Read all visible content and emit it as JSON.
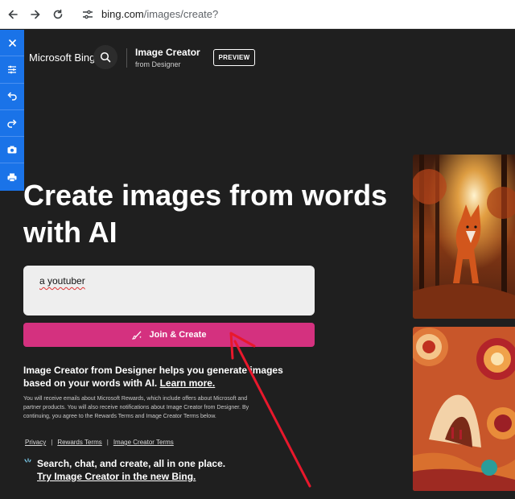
{
  "browser": {
    "url_host": "bing.com",
    "url_path": "/images/create?"
  },
  "side_toolbar": {
    "tools": [
      "close-icon",
      "sliders-icon",
      "undo-icon",
      "redo-icon",
      "camera-icon",
      "print-icon"
    ]
  },
  "header": {
    "brand": "Microsoft Bing",
    "product_title": "Image Creator",
    "product_subtitle": "from Designer",
    "badge": "PREVIEW"
  },
  "hero": {
    "headline": "Create images from words with AI"
  },
  "prompt": {
    "value": "a youtuber"
  },
  "actions": {
    "join_label": "Join & Create"
  },
  "description": {
    "text": "Image Creator from Designer helps you generate images based on your words with AI. ",
    "learn_more": "Learn more.",
    "fine_print": "You will receive emails about Microsoft Rewards, which include offers about Microsoft and partner products. You will also receive notifications about Image Creator from Designer. By continuing, you agree to the Rewards Terms and Image Creator Terms below."
  },
  "footer": {
    "privacy": "Privacy",
    "rewards_terms": "Rewards Terms",
    "ic_terms": "Image Creator Terms",
    "separator": "|"
  },
  "promo": {
    "line1": "Search, chat, and create, all in one place.",
    "line2": "Try Image Creator in the new Bing."
  },
  "colors": {
    "page_bg": "#1f1f1f",
    "join_button": "#d4317f",
    "toolbar_blue": "#1a73e8",
    "annotation_arrow": "#e8182c"
  }
}
